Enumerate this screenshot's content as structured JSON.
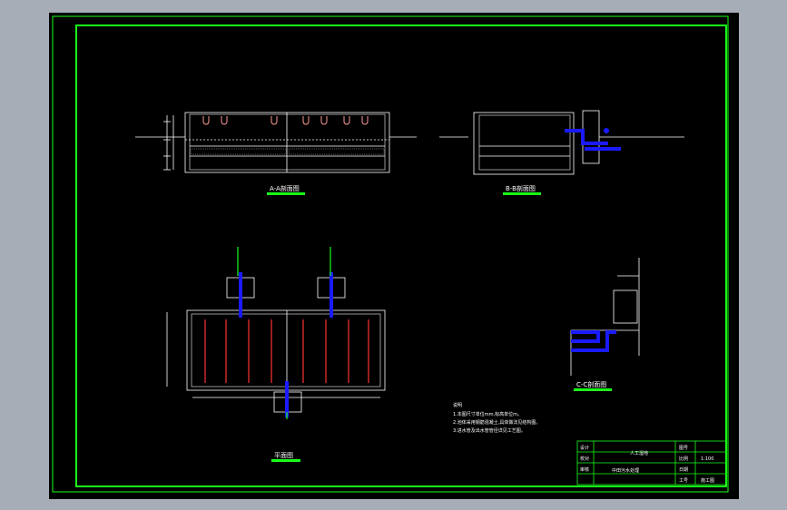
{
  "views": {
    "aa": {
      "title": "A-A剖面图"
    },
    "bb": {
      "title": "B-B剖面图"
    },
    "cc": {
      "title": "C-C剖面图"
    },
    "plan": {
      "title": "平面图"
    }
  },
  "notes": {
    "header": "说明",
    "lines": [
      "1.本图尺寸单位mm,标高单位m。",
      "2.池体采用钢筋混凝土,具体做法见结构图。",
      "3.进水管及出水管管径详见工艺图。"
    ]
  },
  "title_block": {
    "project": "中田污水处理",
    "drawing_name": "人工湿地",
    "stage": "施工图",
    "scale": "1:100",
    "rows_left": [
      "设计",
      "校对",
      "审核"
    ],
    "rows_right_labels": [
      "图号",
      "比例",
      "日期",
      "工号"
    ]
  },
  "colors": {
    "frame": "#19ff19",
    "pipe": "#1a1aff",
    "line": "#ffffff",
    "accent": "#ff3333"
  }
}
